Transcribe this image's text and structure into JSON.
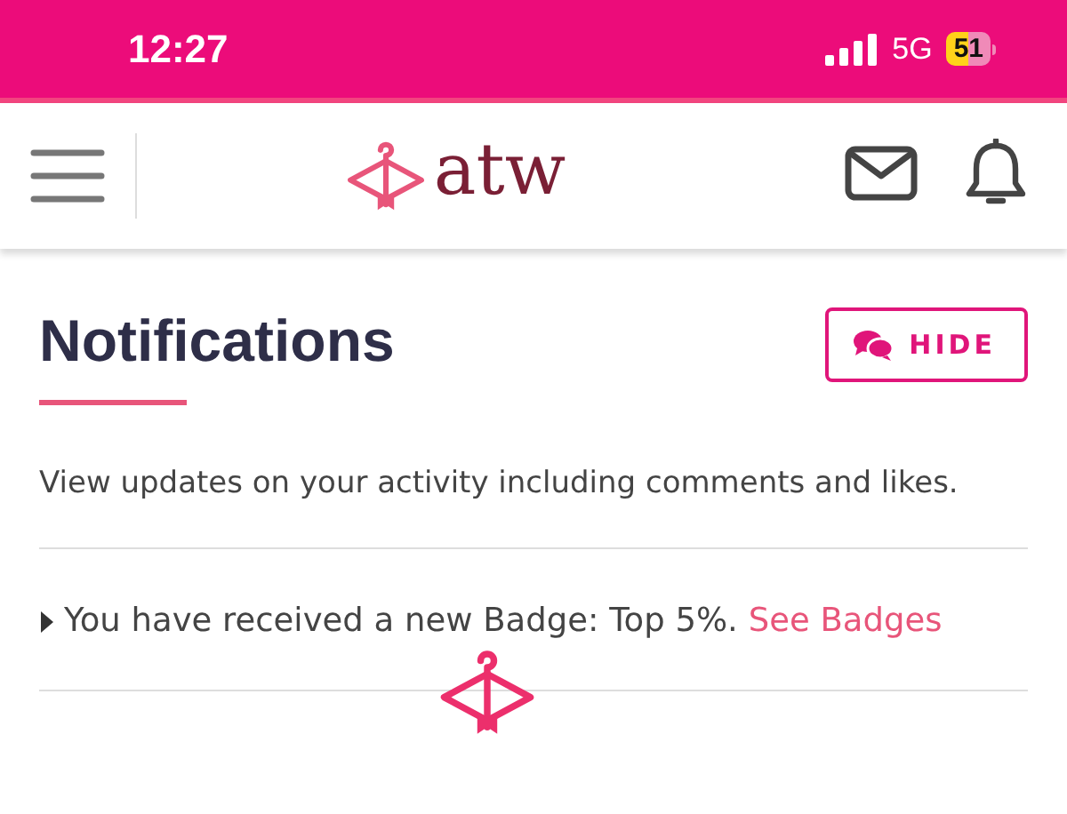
{
  "status_bar": {
    "time": "12:27",
    "network": "5G",
    "battery": "51"
  },
  "header": {
    "logo": "atw"
  },
  "page": {
    "title": "Notifications",
    "hide_button": "HIDE",
    "description": "View updates on your activity including comments and likes.",
    "notifications": [
      {
        "text": "You have received a new Badge: Top 5%.",
        "link": "See Badges"
      }
    ]
  }
}
